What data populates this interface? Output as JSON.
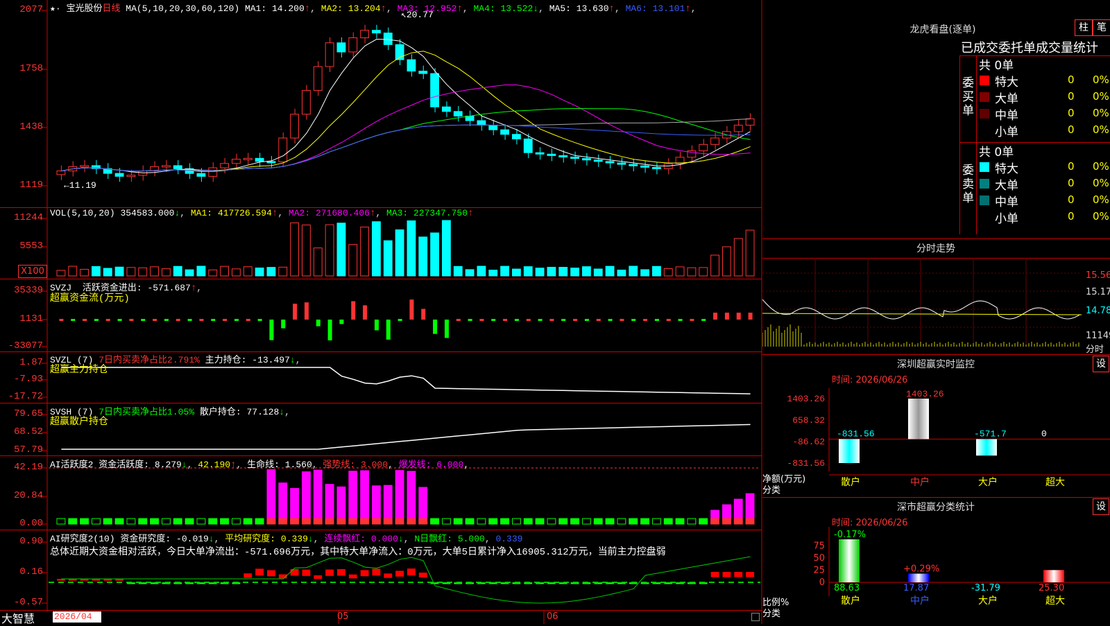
{
  "stock": {
    "name": "宝光股份",
    "period": "日线"
  },
  "kline": {
    "ma_header": "MA(5,10,20,30,60,120)",
    "ma": [
      {
        "label": "MA1:",
        "value": "14.200",
        "arrow": "↑",
        "color": "#ffffff"
      },
      {
        "label": "MA2:",
        "value": "13.204",
        "arrow": "↑",
        "color": "#ffff00"
      },
      {
        "label": "MA3:",
        "value": "12.952",
        "arrow": "↑",
        "color": "#ff00ff"
      },
      {
        "label": "MA4:",
        "value": "13.522",
        "arrow": "↓",
        "color": "#00ff00"
      },
      {
        "label": "MA5:",
        "value": "13.630",
        "arrow": "↑",
        "color": "#ffffff"
      },
      {
        "label": "MA6:",
        "value": "13.101",
        "arrow": "↑",
        "color": "#3a5cff"
      }
    ],
    "axis": [
      "2077",
      "1758",
      "1438",
      "1119"
    ],
    "high_label": "20.77",
    "low_label": "←11.19"
  },
  "vol": {
    "header": "VOL(5,10,20)",
    "value": "354583.000",
    "ma1": "417726.594",
    "ma2": "271680.406",
    "ma3": "227347.750",
    "axis": [
      "11244",
      "5553"
    ],
    "unit": "X100"
  },
  "svzj": {
    "name": "SVZJ",
    "label": "活跃资金进出:",
    "value": "-571.687",
    "sub": "超赢资金流(万元)",
    "axis": [
      "35339",
      "1131",
      "-33077"
    ]
  },
  "svzl": {
    "name": "SVZL (7)",
    "pct": "7日内买卖净占比2.791%",
    "label": "主力持仓:",
    "value": "-13.497",
    "sub": "超赢主力持仓",
    "axis": [
      "1.87",
      "-7.93",
      "-17.72"
    ]
  },
  "svsh": {
    "name": "SVSH (7)",
    "pct": "7日内买卖净占比1.05%",
    "label": "散户持仓:",
    "value": "77.128",
    "sub": "超赢散户持仓",
    "axis": [
      "79.65",
      "68.52",
      "57.79"
    ]
  },
  "ai_active": {
    "name": "AI活跃度2",
    "l1": "资金活跃度:",
    "v1": "8.279",
    "v2": "42.190",
    "l3": "生命线:",
    "v3": "1.560",
    "l4": "强势线:",
    "v4": "3.000",
    "l5": "爆发线:",
    "v5": "6.000",
    "axis": [
      "42.19",
      "20.84",
      "0.00"
    ]
  },
  "ai_research": {
    "name": "AI研究度2(10)",
    "l1": "资金研究度:",
    "v1": "-0.019",
    "l2": "平均研究度:",
    "v2": "0.339",
    "l3": "连续飘红:",
    "v3": "0.000",
    "l4": "N日飘红:",
    "v4": "5.000",
    "v5": "0.339",
    "summary": "总体近期大资金相对活跃，今日大单净流出：-571.696万元，其中特大单净流入：0万元，大单5日累计净入16905.312万元，当前主力控盘弱",
    "axis": [
      "0.90",
      "0.16",
      "-0.57"
    ]
  },
  "dates": {
    "d1": "2026/04",
    "d2": "05",
    "d3": "06"
  },
  "brand": "大智慧",
  "lhb": {
    "title": "龙虎看盘(逐单)",
    "btn1": "柱",
    "btn2": "笔",
    "subtitle": "已成交委托单成交量统计",
    "buy_side": "委买单",
    "sell_side": "委卖单",
    "buy_total": "共 0单",
    "sell_total": "共 0单",
    "buy_rows": [
      {
        "label": "特大",
        "n": "0",
        "pct": "0%",
        "color": "#ff0000"
      },
      {
        "label": "大单",
        "n": "0",
        "pct": "0%",
        "color": "#800000"
      },
      {
        "label": "中单",
        "n": "0",
        "pct": "0%",
        "color": "#600000"
      },
      {
        "label": "小单",
        "n": "0",
        "pct": "0%",
        "color": ""
      }
    ],
    "sell_rows": [
      {
        "label": "特大",
        "n": "0",
        "pct": "0%",
        "color": "#00ffff"
      },
      {
        "label": "大单",
        "n": "0",
        "pct": "0%",
        "color": "#008080"
      },
      {
        "label": "中单",
        "n": "0",
        "pct": "0%",
        "color": "#007070"
      },
      {
        "label": "小单",
        "n": "0",
        "pct": "0%",
        "color": ""
      }
    ]
  },
  "intraday": {
    "title": "分时走势",
    "axis": [
      "15.56",
      "15.17",
      "14.78",
      "11149"
    ],
    "unit": "分时"
  },
  "monitor": {
    "title": "深圳超赢实时监控",
    "btn": "设",
    "time": "时间: 2026/06/26",
    "axis": [
      "1403.26",
      "658.32",
      "-86.62",
      "-831.56"
    ],
    "ylabel1": "净额(万元)",
    "ylabel2": "分类",
    "bars": [
      {
        "cat": "散户",
        "value": "-831.56"
      },
      {
        "cat": "中户",
        "value": "1403.26"
      },
      {
        "cat": "大户",
        "value": "-571.7"
      },
      {
        "cat": "超大",
        "value": "0"
      }
    ]
  },
  "classify": {
    "title": "深市超赢分类统计",
    "btn": "设",
    "time": "时间: 2026/06/26",
    "axis": [
      "75",
      "50",
      "25",
      "0"
    ],
    "ylabel1": "比例%",
    "ylabel2": "分类",
    "bars": [
      {
        "cat": "散户",
        "value": "88.63",
        "top": "-0.17%"
      },
      {
        "cat": "中户",
        "value": "17.87",
        "top": "+0.29%"
      },
      {
        "cat": "大户",
        "value": "-31.79",
        "top": ""
      },
      {
        "cat": "超大",
        "value": "25.30",
        "top": ""
      }
    ]
  }
}
